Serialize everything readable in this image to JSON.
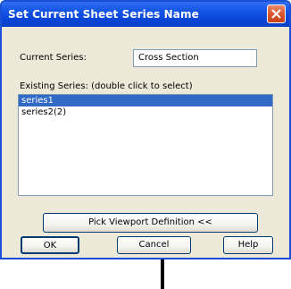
{
  "window": {
    "title": "Set Current Sheet Series Name"
  },
  "current_series": {
    "label": "Current Series:",
    "value": "Cross Section"
  },
  "existing_series": {
    "label": "Existing Series: (double click to select)",
    "items": [
      "series1",
      "series2(2)"
    ],
    "selected_index": 0
  },
  "buttons": {
    "pick_viewport": "Pick Viewport Definition <<",
    "ok": "OK",
    "cancel": "Cancel",
    "help": "Help"
  },
  "icons": {
    "close": "close-icon"
  },
  "colors": {
    "titlebar": "#0a45d8",
    "selection": "#316ac5",
    "close_button": "#d9562f",
    "dialog_background": "#ece9d8"
  }
}
